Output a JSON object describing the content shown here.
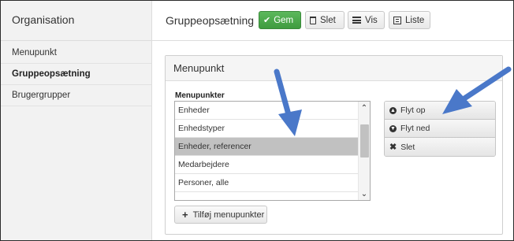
{
  "sidebar": {
    "title": "Organisation",
    "items": [
      {
        "label": "Menupunkt"
      },
      {
        "label": "Gruppeopsætning"
      },
      {
        "label": "Brugergrupper"
      }
    ]
  },
  "toolbar": {
    "title": "Gruppeopsætning",
    "save_label": "Gem",
    "delete_label": "Slet",
    "view_label": "Vis",
    "list_label": "Liste"
  },
  "panel": {
    "heading": "Menupunkt",
    "list_label": "Menupunkter",
    "items": [
      {
        "label": "Enheder"
      },
      {
        "label": "Enhedstyper"
      },
      {
        "label": "Enheder, referencer"
      },
      {
        "label": "Medarbejdere"
      },
      {
        "label": "Personer, alle"
      }
    ],
    "add_label": "Tilføj menupunkter",
    "move_up_label": "Flyt op",
    "move_down_label": "Flyt ned",
    "remove_label": "Slet"
  },
  "colors": {
    "accent": "#4cae4c",
    "annotation_arrow": "#4a78c9",
    "selected_row": "#c1c1c1"
  },
  "icons": [
    "check-icon",
    "trash-icon",
    "list-icon",
    "window-icon",
    "plus-icon",
    "arrow-up-circle-icon",
    "arrow-down-circle-icon",
    "close-icon",
    "chevron-up-icon",
    "chevron-down-icon"
  ]
}
